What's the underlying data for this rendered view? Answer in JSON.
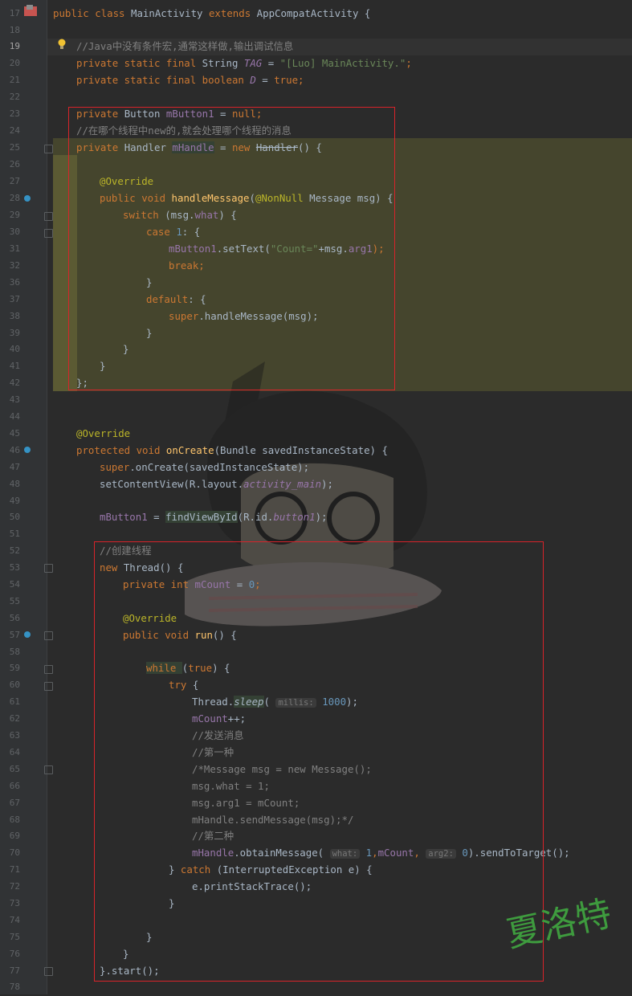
{
  "editor": {
    "language": "Java",
    "colors": {
      "background": "#2b2b2b",
      "keyword": "#cc7832",
      "comment": "#808080",
      "string": "#6a8759",
      "annotation": "#bbb529",
      "number": "#6897bb",
      "method": "#ffc66d",
      "field": "#9876aa",
      "highlight_box": "#d8232a"
    },
    "current_line": "19",
    "lines": [
      {
        "n": "17",
        "text": "public class MainActivity extends AppCompatActivity {"
      },
      {
        "n": "18",
        "text": ""
      },
      {
        "n": "19",
        "text": "//Java中没有条件宏,通常这样做,输出调试信息"
      },
      {
        "n": "20",
        "text": "private static final String TAG = \"[Luo] MainActivity.\";"
      },
      {
        "n": "21",
        "text": "private static final boolean D = true;"
      },
      {
        "n": "22",
        "text": ""
      },
      {
        "n": "23",
        "text": "private Button mButton1 = null;"
      },
      {
        "n": "24",
        "text": "//在哪个线程中new的,就会处理哪个线程的消息"
      },
      {
        "n": "25",
        "text": "private Handler mHandle = new Handler() {"
      },
      {
        "n": "26",
        "text": ""
      },
      {
        "n": "27",
        "text": "@Override"
      },
      {
        "n": "28",
        "text": "public void handleMessage(@NonNull Message msg) {"
      },
      {
        "n": "29",
        "text": "switch (msg.what) {"
      },
      {
        "n": "30",
        "text": "case 1: {"
      },
      {
        "n": "31",
        "text": "mButton1.setText(\"Count=\"+msg.arg1);"
      },
      {
        "n": "32",
        "text": "break;"
      },
      {
        "n": "36",
        "text": "}"
      },
      {
        "n": "37",
        "text": "default: {"
      },
      {
        "n": "38",
        "text": "super.handleMessage(msg);"
      },
      {
        "n": "39",
        "text": "}"
      },
      {
        "n": "40",
        "text": "}"
      },
      {
        "n": "41",
        "text": "}"
      },
      {
        "n": "42",
        "text": "};"
      },
      {
        "n": "43",
        "text": ""
      },
      {
        "n": "44",
        "text": ""
      },
      {
        "n": "45",
        "text": "@Override"
      },
      {
        "n": "46",
        "text": "protected void onCreate(Bundle savedInstanceState) {"
      },
      {
        "n": "47",
        "text": "super.onCreate(savedInstanceState);"
      },
      {
        "n": "48",
        "text": "setContentView(R.layout.activity_main);"
      },
      {
        "n": "49",
        "text": ""
      },
      {
        "n": "50",
        "text": "mButton1 = findViewById(R.id.button1);"
      },
      {
        "n": "51",
        "text": ""
      },
      {
        "n": "52",
        "text": "//创建线程"
      },
      {
        "n": "53",
        "text": "new Thread() {"
      },
      {
        "n": "54",
        "text": "private int mCount = 0;"
      },
      {
        "n": "55",
        "text": ""
      },
      {
        "n": "56",
        "text": "@Override"
      },
      {
        "n": "57",
        "text": "public void run() {"
      },
      {
        "n": "58",
        "text": ""
      },
      {
        "n": "59",
        "text": "while (true) {"
      },
      {
        "n": "60",
        "text": "try {"
      },
      {
        "n": "61",
        "text": "Thread.sleep( millis: 1000);"
      },
      {
        "n": "62",
        "text": "mCount++;"
      },
      {
        "n": "63",
        "text": "//发送消息"
      },
      {
        "n": "64",
        "text": "//第一种"
      },
      {
        "n": "65",
        "text": "/*Message msg = new Message();"
      },
      {
        "n": "66",
        "text": "msg.what = 1;"
      },
      {
        "n": "67",
        "text": "msg.arg1 = mCount;"
      },
      {
        "n": "68",
        "text": "mHandle.sendMessage(msg);*/"
      },
      {
        "n": "69",
        "text": "//第二种"
      },
      {
        "n": "70",
        "text": "mHandle.obtainMessage( what: 1,mCount, arg2: 0).sendToTarget();"
      },
      {
        "n": "71",
        "text": "} catch (InterruptedException e) {"
      },
      {
        "n": "72",
        "text": "e.printStackTrace();"
      },
      {
        "n": "73",
        "text": "}"
      },
      {
        "n": "74",
        "text": ""
      },
      {
        "n": "75",
        "text": "}"
      },
      {
        "n": "76",
        "text": "}"
      },
      {
        "n": "77",
        "text": "}.start();"
      },
      {
        "n": "78",
        "text": ""
      }
    ],
    "tokens": {
      "l17": [
        "public class ",
        "MainActivity ",
        "extends ",
        "AppCompatActivity {"
      ],
      "l19": "//Java中没有条件宏,通常这样做,输出调试信息",
      "l20": [
        "private static final ",
        "String ",
        "TAG",
        " = ",
        "\"[Luo] MainActivity.\"",
        ";"
      ],
      "l21": [
        "private static final boolean ",
        "D",
        " = ",
        "true",
        ";"
      ],
      "l23": [
        "private ",
        "Button ",
        "mButton1",
        " = ",
        "null",
        ";"
      ],
      "l24": "//在哪个线程中new的,就会处理哪个线程的消息",
      "l25": [
        "private ",
        "Handler ",
        "mHandle",
        " = ",
        "new ",
        "Handler",
        "() {"
      ],
      "l27": "@Override",
      "l28": [
        "public void ",
        "handleMessage",
        "(",
        "@NonNull ",
        "Message msg) {"
      ],
      "l29": [
        "switch ",
        "(msg.",
        "what",
        ") {"
      ],
      "l30": [
        "case ",
        "1",
        ": {"
      ],
      "l31": [
        "mButton1",
        ".setText(",
        "\"Count=\"",
        "+msg.",
        "arg1",
        ");"
      ],
      "l32": "break;",
      "l36": "}",
      "l37": [
        "default",
        ": {"
      ],
      "l38": [
        "super",
        ".handleMessage(msg);"
      ],
      "l39": "}",
      "l40": "}",
      "l41": "}",
      "l42": "};",
      "l45": "@Override",
      "l46": [
        "protected void ",
        "onCreate",
        "(Bundle savedInstanceState) {"
      ],
      "l47": [
        "super",
        ".onCreate(savedInstanceState);"
      ],
      "l48": [
        "setContentView(R.layout.",
        "activity_main",
        ");"
      ],
      "l50": [
        "mButton1",
        " = ",
        "findViewById",
        "(R.id.",
        "button1",
        ");"
      ],
      "l52": "//创建线程",
      "l53": [
        "new ",
        "Thread() {"
      ],
      "l54": [
        "private int ",
        "mCount",
        " = ",
        "0",
        ";"
      ],
      "l56": "@Override",
      "l57": [
        "public void ",
        "run",
        "() {"
      ],
      "l59": [
        "while ",
        "(",
        "true",
        ") {"
      ],
      "l60": [
        "try ",
        "{"
      ],
      "l61": [
        "Thread.",
        "sleep",
        "( ",
        "millis:",
        " ",
        "1000",
        ");"
      ],
      "l62": [
        "mCount",
        "++;"
      ],
      "l63": "//发送消息",
      "l64": "//第一种",
      "l65": "/*Message msg = new Message();",
      "l66": "msg.what = 1;",
      "l67": "msg.arg1 = mCount;",
      "l68": "mHandle.sendMessage(msg);*/",
      "l69": "//第二种",
      "l70": [
        "mHandle",
        ".obtainMessage( ",
        "what:",
        " ",
        "1",
        ",",
        "mCount",
        ", ",
        "arg2:",
        " ",
        "0",
        ").sendToTarget();"
      ],
      "l71": [
        "} ",
        "catch ",
        "(InterruptedException e) {"
      ],
      "l72": "e.printStackTrace();",
      "l73": "}",
      "l75": "}",
      "l76": "}",
      "l77": "}.start();"
    },
    "watermark_text": "夏洛特"
  }
}
